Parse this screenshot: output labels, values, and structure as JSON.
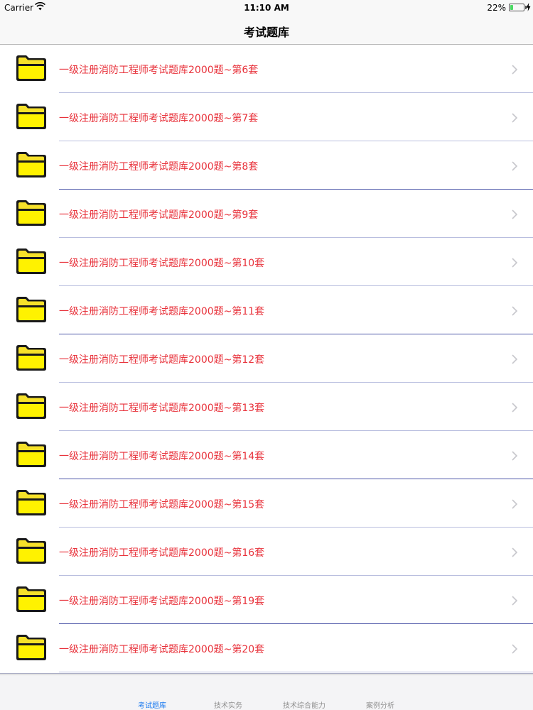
{
  "status_bar": {
    "carrier": "Carrier",
    "time": "11:10 AM",
    "battery_pct": "22%",
    "battery_level": 0.22,
    "battery_color": "#4cd964",
    "wifi_icon": "wifi-icon",
    "charging_icon": "bolt-icon"
  },
  "nav": {
    "title": "考试题库"
  },
  "list": {
    "row_icon": "folder-icon",
    "disclosure_icon": "chevron-right-icon",
    "label_color": "#e8323b",
    "items": [
      {
        "label": "一级注册消防工程师考试题库2000题~第6套"
      },
      {
        "label": "一级注册消防工程师考试题库2000题~第7套"
      },
      {
        "label": "一级注册消防工程师考试题库2000题~第8套"
      },
      {
        "label": "一级注册消防工程师考试题库2000题~第9套"
      },
      {
        "label": "一级注册消防工程师考试题库2000题~第10套"
      },
      {
        "label": "一级注册消防工程师考试题库2000题~第11套"
      },
      {
        "label": "一级注册消防工程师考试题库2000题~第12套"
      },
      {
        "label": "一级注册消防工程师考试题库2000题~第13套"
      },
      {
        "label": "一级注册消防工程师考试题库2000题~第14套"
      },
      {
        "label": "一级注册消防工程师考试题库2000题~第15套"
      },
      {
        "label": "一级注册消防工程师考试题库2000题~第16套"
      },
      {
        "label": "一级注册消防工程师考试题库2000题~第19套"
      },
      {
        "label": "一级注册消防工程师考试题库2000题~第20套"
      }
    ]
  },
  "tabs": {
    "active_color": "#1a7af0",
    "inactive_color": "#929292",
    "items": [
      {
        "label": "考试题库",
        "active": true
      },
      {
        "label": "技术实务",
        "active": false
      },
      {
        "label": "技术综合能力",
        "active": false
      },
      {
        "label": "案例分析",
        "active": false
      }
    ]
  }
}
